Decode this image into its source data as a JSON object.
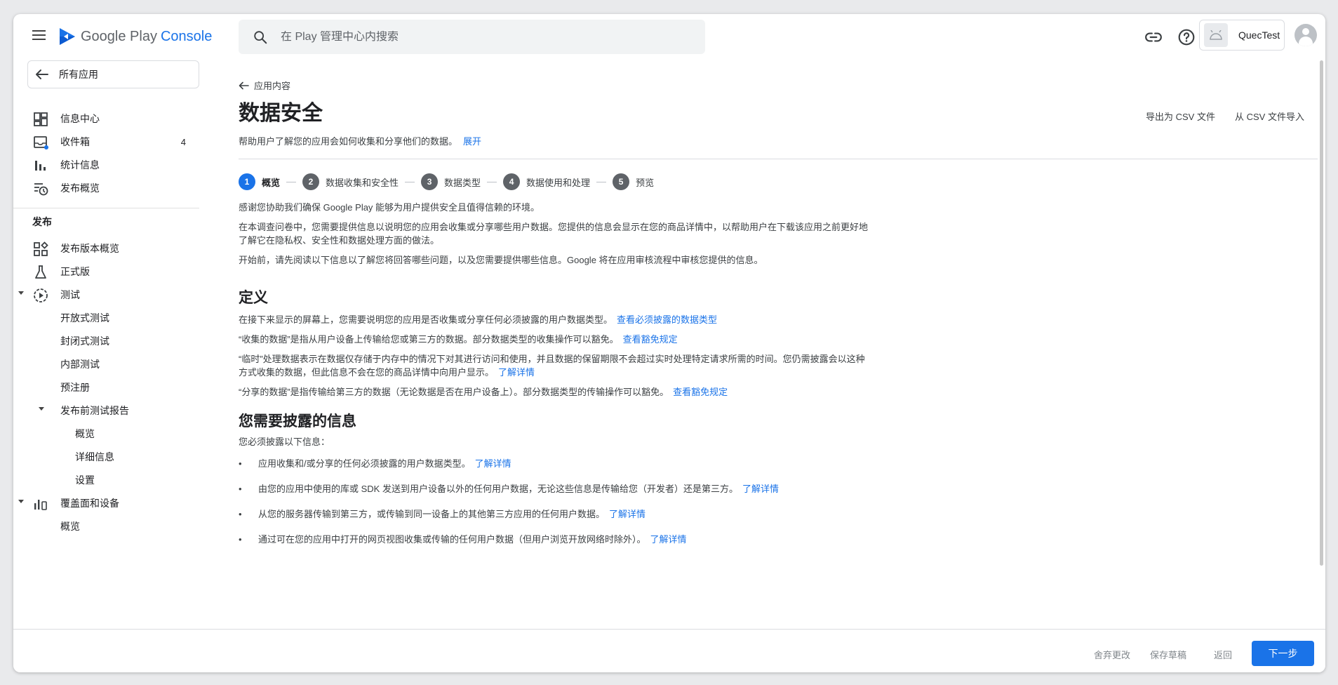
{
  "topbar": {
    "logo_text": "Google Play",
    "logo_accent": "Console",
    "search_placeholder": "在 Play 管理中心内搜索",
    "account_name": "QuecTest"
  },
  "sidebar": {
    "all_apps": "所有应用",
    "items": [
      {
        "label": "信息中心",
        "icon": "dashboard-icon"
      },
      {
        "label": "收件箱",
        "icon": "inbox-icon",
        "badge": "4"
      },
      {
        "label": "统计信息",
        "icon": "bar-chart-icon"
      },
      {
        "label": "发布概览",
        "icon": "history-icon"
      }
    ],
    "section": "发布",
    "release_items": [
      {
        "label": "发布版本概览"
      },
      {
        "label": "正式版"
      },
      {
        "label": "测试"
      },
      {
        "label": "开放式测试"
      },
      {
        "label": "封闭式测试"
      },
      {
        "label": "内部测试"
      },
      {
        "label": "预注册"
      },
      {
        "label": "发布前测试报告"
      },
      {
        "label": "概览"
      },
      {
        "label": "详细信息"
      },
      {
        "label": "设置"
      },
      {
        "label": "覆盖面和设备"
      },
      {
        "label": "概览"
      }
    ]
  },
  "main": {
    "back_link": "应用内容",
    "title": "数据安全",
    "description": "帮助用户了解您的应用会如何收集和分享他们的数据。",
    "expand_link": "展开",
    "export_csv": "导出为 CSV 文件",
    "import_csv": "从 CSV 文件导入",
    "steps": [
      {
        "num": "1",
        "label": "概览"
      },
      {
        "num": "2",
        "label": "数据收集和安全性"
      },
      {
        "num": "3",
        "label": "数据类型"
      },
      {
        "num": "4",
        "label": "数据使用和处理"
      },
      {
        "num": "5",
        "label": "预览"
      }
    ],
    "intro": [
      "感谢您协助我们确保 Google Play 能够为用户提供安全且值得信赖的环境。",
      "在本调查问卷中，您需要提供信息以说明您的应用会收集或分享哪些用户数据。您提供的信息会显示在您的商品详情中，以帮助用户在下载该应用之前更好地了解它在隐私权、安全性和数据处理方面的做法。",
      "开始前，请先阅读以下信息以了解您将回答哪些问题，以及您需要提供哪些信息。Google 将在应用审核流程中审核您提供的信息。"
    ],
    "definitions_title": "定义",
    "definitions": [
      {
        "text": "在接下来显示的屏幕上，您需要说明您的应用是否收集或分享任何必须披露的用户数据类型。",
        "link": "查看必须披露的数据类型"
      },
      {
        "text": "“收集的数据”是指从用户设备上传输给您或第三方的数据。部分数据类型的收集操作可以豁免。",
        "link": "查看豁免规定"
      },
      {
        "text": "“临时”处理数据表示在数据仅存储于内存中的情况下对其进行访问和使用，并且数据的保留期限不会超过实时处理特定请求所需的时间。您仍需披露会以这种方式收集的数据，但此信息不会在您的商品详情中向用户显示。",
        "link": "了解详情"
      },
      {
        "text": "“分享的数据”是指传输给第三方的数据（无论数据是否在用户设备上）。部分数据类型的传输操作可以豁免。",
        "link": "查看豁免规定"
      }
    ],
    "disclose_title": "您需要披露的信息",
    "disclose_intro": "您必须披露以下信息：",
    "disclose_items": [
      {
        "text": "应用收集和/或分享的任何必须披露的用户数据类型。",
        "link": "了解详情"
      },
      {
        "text": "由您的应用中使用的库或 SDK 发送到用户设备以外的任何用户数据，无论这些信息是传输给您（开发者）还是第三方。",
        "link": "了解详情"
      },
      {
        "text": "从您的服务器传输到第三方，或传输到同一设备上的其他第三方应用的任何用户数据。",
        "link": "了解详情"
      },
      {
        "text": "通过可在您的应用中打开的网页视图收集或传输的任何用户数据（但用户浏览开放网络时除外）。",
        "link": "了解详情"
      }
    ]
  },
  "footer": {
    "discard": "舍弃更改",
    "save_draft": "保存草稿",
    "back": "返回",
    "next": "下一步"
  },
  "colors": {
    "accent": "#1a73e8",
    "step_inactive": "#5f6368"
  }
}
